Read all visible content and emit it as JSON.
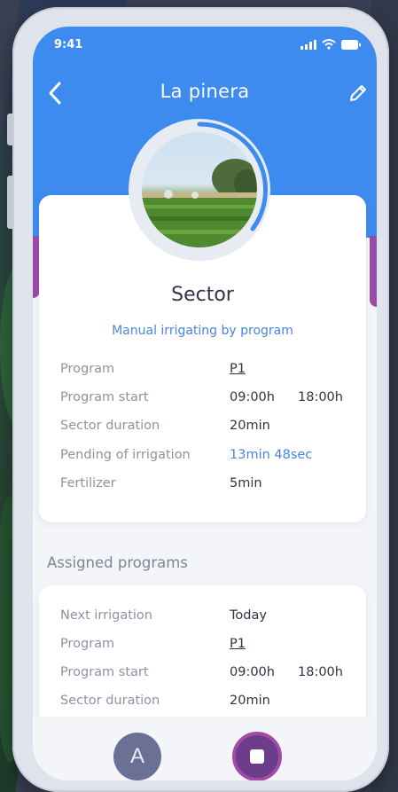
{
  "status_bar": {
    "time": "9:41"
  },
  "nav": {
    "title": "La pinera",
    "back_icon": "chevron-left-icon",
    "edit_icon": "pencil-icon"
  },
  "sector": {
    "title": "Sector",
    "mode": "Manual irrigating by program",
    "details": [
      {
        "label": "Program",
        "value": "P1"
      },
      {
        "label": "Program start",
        "value": "09:00h",
        "value2": "18:00h"
      },
      {
        "label": "Sector duration",
        "value": "20min"
      },
      {
        "label": "Pending of irrigation",
        "value": "13min 48sec"
      },
      {
        "label": "Fertilizer",
        "value": "5min"
      }
    ]
  },
  "assigned": {
    "heading": "Assigned programs",
    "details": [
      {
        "label": "Next irrigation",
        "value": "Today"
      },
      {
        "label": "Program",
        "value": "P1"
      },
      {
        "label": "Program start",
        "value": "09:00h",
        "value2": "18:00h"
      },
      {
        "label": "Sector duration",
        "value": "20min"
      }
    ]
  },
  "bottom": {
    "mode_button": "A",
    "stop_icon": "stop-icon"
  },
  "colors": {
    "header": "#3e8bf0",
    "accent": "#9a4aa8",
    "link": "#4a84e0"
  }
}
